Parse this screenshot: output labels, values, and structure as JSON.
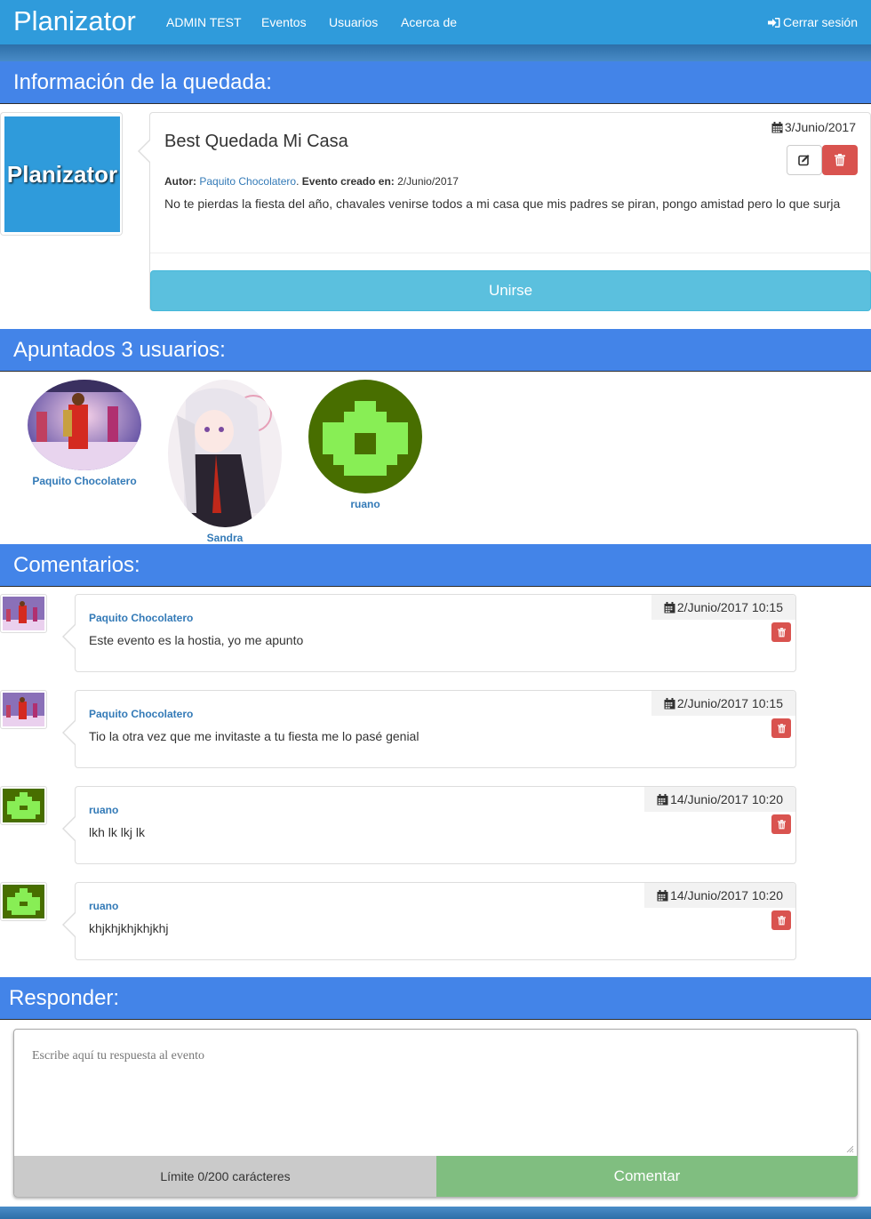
{
  "navbar": {
    "brand": "Planizator",
    "links": [
      "ADMIN TEST",
      "Eventos",
      "Usuarios",
      "Acerca de"
    ],
    "logout": "Cerrar sesión"
  },
  "sections": {
    "info": "Información de la quedada:",
    "attendees": "Apuntados 3 usuarios:",
    "comments": "Comentarios:",
    "reply": "Responder:"
  },
  "event": {
    "logo_text": "Planizator",
    "date": "3/Junio/2017",
    "title": "Best Quedada Mi Casa",
    "author_label": "Autor:",
    "author": "Paquito Chocolatero",
    "created_label": "Evento creado en:",
    "created": "2/Junio/2017",
    "description": "No te pierdas la fiesta del año, chavales venirse todos a mi casa que mis padres se piran, pongo amistad pero lo que surja",
    "join_label": "Unirse"
  },
  "attendees": [
    {
      "name": "Paquito Chocolatero"
    },
    {
      "name": "Sandra"
    },
    {
      "name": "ruano"
    }
  ],
  "comments": [
    {
      "user": "Paquito Chocolatero",
      "date": "2/Junio/2017 10:15",
      "text": "Este evento es la hostia, yo me apunto"
    },
    {
      "user": "Paquito Chocolatero",
      "date": "2/Junio/2017 10:15",
      "text": "Tio la otra vez que me invitaste a tu fiesta me lo pasé genial"
    },
    {
      "user": "ruano",
      "date": "14/Junio/2017 10:20",
      "text": "lkh lk lkj lk"
    },
    {
      "user": "ruano",
      "date": "14/Junio/2017 10:20",
      "text": "khjkhjkhjkhjkhj"
    }
  ],
  "reply": {
    "placeholder": "Escribe aquí tu respuesta al evento",
    "limit": "Límite 0/200 carácteres",
    "submit": "Comentar"
  },
  "colors": {
    "navbar": "#2f9bdb",
    "section_header": "#4384e8",
    "link": "#337ab7",
    "danger": "#d9534f",
    "info_button": "#5bc0de",
    "success_button": "#80be80"
  }
}
